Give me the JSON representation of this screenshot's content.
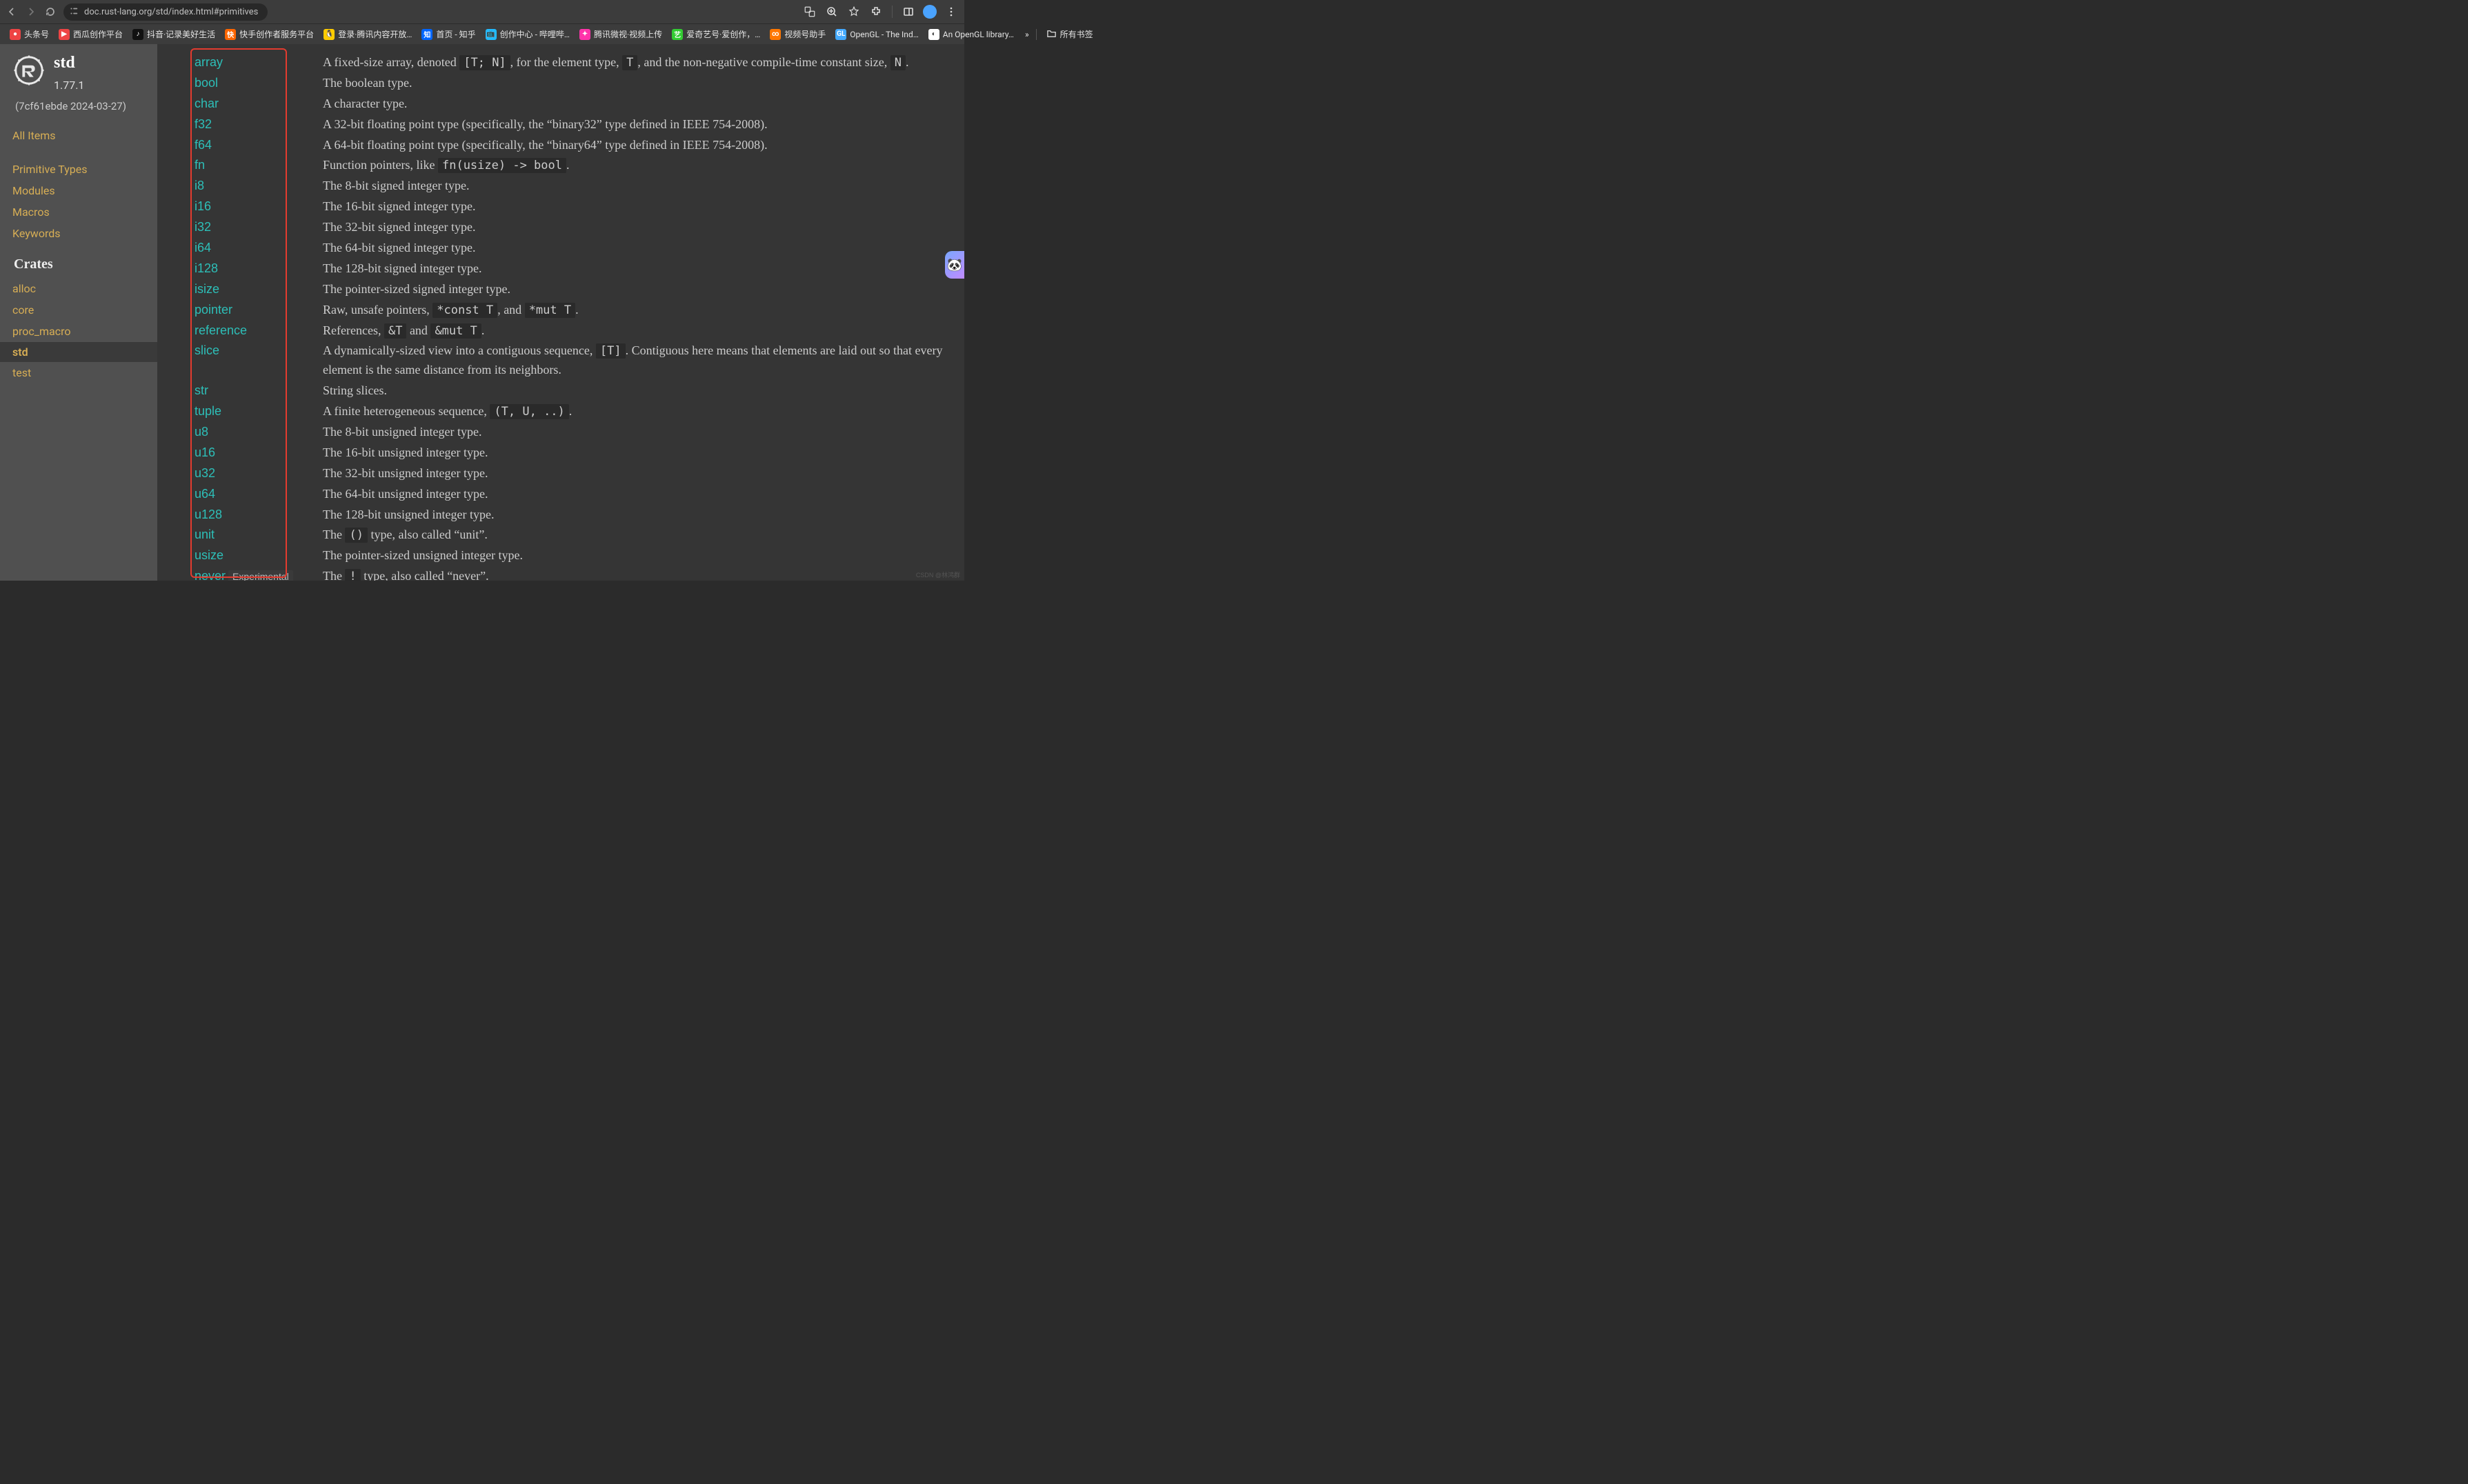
{
  "browser": {
    "url": "doc.rust-lang.org/std/index.html#primitives",
    "bookmarks": [
      {
        "label": "头条号",
        "color": "#e44"
      },
      {
        "label": "西瓜创作平台",
        "color": "#e44",
        "icon": "▶"
      },
      {
        "label": "抖音·记录美好生活",
        "color": "#111",
        "icon": "♪"
      },
      {
        "label": "快手创作者服务平台",
        "color": "#f60",
        "icon": "快"
      },
      {
        "label": "登录·腾讯内容开放…",
        "color": "#fc0",
        "icon": "🐧"
      },
      {
        "label": "首页 - 知乎",
        "color": "#06f",
        "icon": "知"
      },
      {
        "label": "创作中心 - 哔哩哔…",
        "color": "#2bf",
        "icon": "📺"
      },
      {
        "label": "腾讯微视·视频上传",
        "color": "#f3a",
        "icon": "✦"
      },
      {
        "label": "爱奇艺号·爱创作，…",
        "color": "#3c3",
        "icon": "艺"
      },
      {
        "label": "视频号助手",
        "color": "#f70",
        "icon": "∞"
      },
      {
        "label": "OpenGL - The Ind…",
        "color": "#4af",
        "icon": "GL"
      },
      {
        "label": "An OpenGL library…",
        "color": "#fff",
        "icon": "◐"
      }
    ],
    "overflow": "»",
    "all_bookmarks": "所有书签"
  },
  "sidebar": {
    "crate": "std",
    "version": "1.77.1",
    "hash": "(7cf61ebde 2024-03-27)",
    "all_items": "All Items",
    "nav": [
      "Primitive Types",
      "Modules",
      "Macros",
      "Keywords"
    ],
    "crates_h": "Crates",
    "crates": [
      "alloc",
      "core",
      "proc_macro",
      "std",
      "test"
    ],
    "current_crate": "std"
  },
  "primitives": [
    {
      "name": "array",
      "desc_parts": [
        [
          "t",
          "A fixed-size array, denoted "
        ],
        [
          "c",
          "[T; N]"
        ],
        [
          "t",
          ", for the element type, "
        ],
        [
          "c",
          "T"
        ],
        [
          "t",
          ", and the non-negative compile-time constant size, "
        ],
        [
          "c",
          "N"
        ],
        [
          "t",
          "."
        ]
      ]
    },
    {
      "name": "bool",
      "desc_parts": [
        [
          "t",
          "The boolean type."
        ]
      ]
    },
    {
      "name": "char",
      "desc_parts": [
        [
          "t",
          "A character type."
        ]
      ]
    },
    {
      "name": "f32",
      "desc_parts": [
        [
          "t",
          "A 32-bit floating point type (specifically, the “binary32” type defined in IEEE 754-2008)."
        ]
      ]
    },
    {
      "name": "f64",
      "desc_parts": [
        [
          "t",
          "A 64-bit floating point type (specifically, the “binary64” type defined in IEEE 754-2008)."
        ]
      ]
    },
    {
      "name": "fn",
      "desc_parts": [
        [
          "t",
          "Function pointers, like "
        ],
        [
          "c",
          "fn(usize) -> bool"
        ],
        [
          "t",
          "."
        ]
      ]
    },
    {
      "name": "i8",
      "desc_parts": [
        [
          "t",
          "The 8-bit signed integer type."
        ]
      ]
    },
    {
      "name": "i16",
      "desc_parts": [
        [
          "t",
          "The 16-bit signed integer type."
        ]
      ]
    },
    {
      "name": "i32",
      "desc_parts": [
        [
          "t",
          "The 32-bit signed integer type."
        ]
      ]
    },
    {
      "name": "i64",
      "desc_parts": [
        [
          "t",
          "The 64-bit signed integer type."
        ]
      ]
    },
    {
      "name": "i128",
      "desc_parts": [
        [
          "t",
          "The 128-bit signed integer type."
        ]
      ]
    },
    {
      "name": "isize",
      "desc_parts": [
        [
          "t",
          "The pointer-sized signed integer type."
        ]
      ]
    },
    {
      "name": "pointer",
      "desc_parts": [
        [
          "t",
          "Raw, unsafe pointers, "
        ],
        [
          "c",
          "*const T"
        ],
        [
          "t",
          ", and "
        ],
        [
          "c",
          "*mut T"
        ],
        [
          "t",
          "."
        ]
      ]
    },
    {
      "name": "reference",
      "desc_parts": [
        [
          "t",
          "References, "
        ],
        [
          "c",
          "&T"
        ],
        [
          "t",
          " and "
        ],
        [
          "c",
          "&mut T"
        ],
        [
          "t",
          "."
        ]
      ]
    },
    {
      "name": "slice",
      "desc_parts": [
        [
          "t",
          "A dynamically-sized view into a contiguous sequence, "
        ],
        [
          "c",
          "[T]"
        ],
        [
          "t",
          ". Contiguous here means that elements are laid out so that every element is the same distance from its neighbors."
        ]
      ]
    },
    {
      "name": "str",
      "desc_parts": [
        [
          "t",
          "String slices."
        ]
      ]
    },
    {
      "name": "tuple",
      "desc_parts": [
        [
          "t",
          "A finite heterogeneous sequence, "
        ],
        [
          "c",
          "(T, U, ..)"
        ],
        [
          "t",
          "."
        ]
      ]
    },
    {
      "name": "u8",
      "desc_parts": [
        [
          "t",
          "The 8-bit unsigned integer type."
        ]
      ]
    },
    {
      "name": "u16",
      "desc_parts": [
        [
          "t",
          "The 16-bit unsigned integer type."
        ]
      ]
    },
    {
      "name": "u32",
      "desc_parts": [
        [
          "t",
          "The 32-bit unsigned integer type."
        ]
      ]
    },
    {
      "name": "u64",
      "desc_parts": [
        [
          "t",
          "The 64-bit unsigned integer type."
        ]
      ]
    },
    {
      "name": "u128",
      "desc_parts": [
        [
          "t",
          "The 128-bit unsigned integer type."
        ]
      ]
    },
    {
      "name": "unit",
      "desc_parts": [
        [
          "t",
          "The "
        ],
        [
          "c",
          "()"
        ],
        [
          "t",
          " type, also called “unit”."
        ]
      ]
    },
    {
      "name": "usize",
      "desc_parts": [
        [
          "t",
          "The pointer-sized unsigned integer type."
        ]
      ]
    },
    {
      "name": "never",
      "badge": "Experimental",
      "desc_parts": [
        [
          "t",
          "The "
        ],
        [
          "c",
          "!"
        ],
        [
          "t",
          " type, also called “never”."
        ]
      ]
    }
  ],
  "watermark": "CSDN @林鸿群"
}
